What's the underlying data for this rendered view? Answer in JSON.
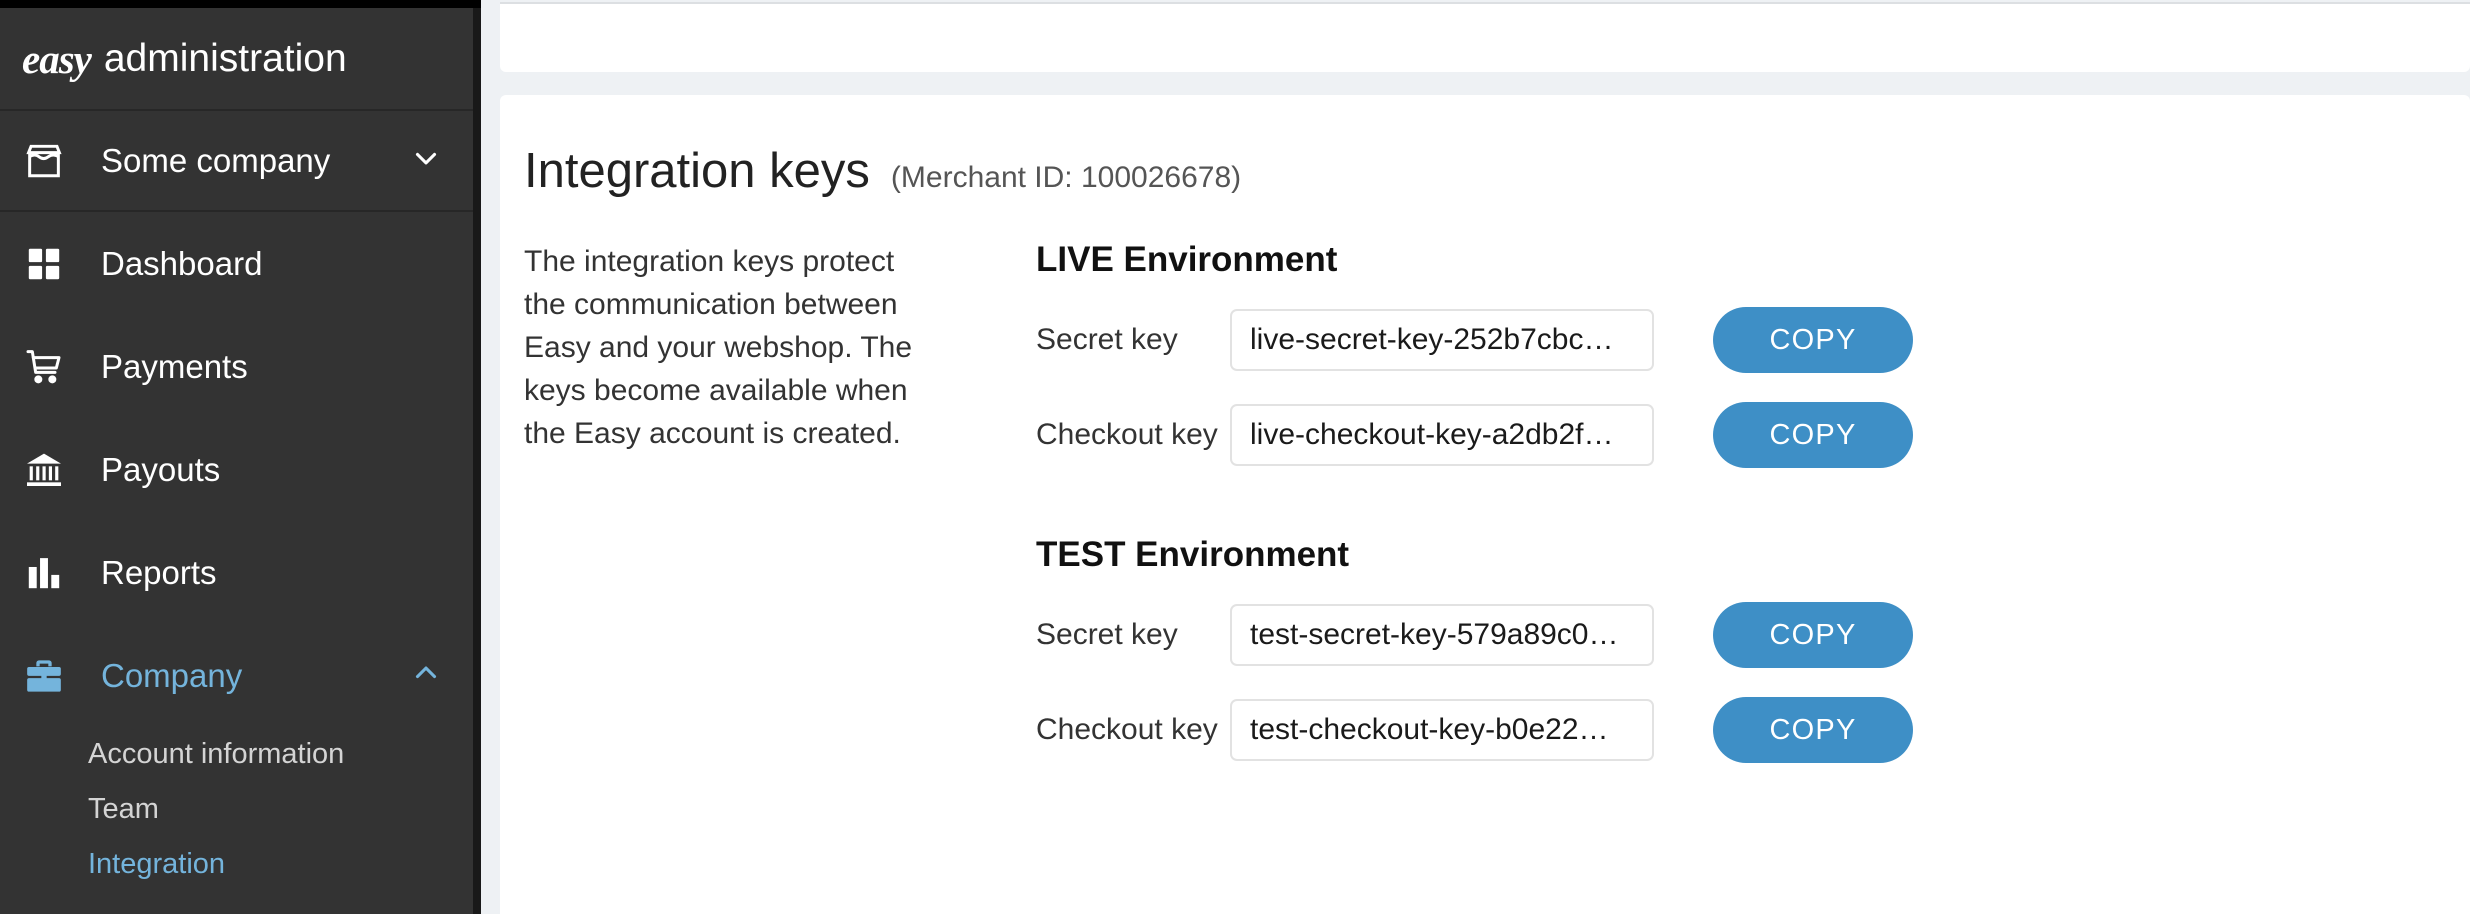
{
  "brand": {
    "logo_text": "easy",
    "app_name": "administration"
  },
  "sidebar": {
    "company_switcher": {
      "label": "Some company",
      "icon": "store-icon",
      "chevron": "chevron-down-icon"
    },
    "items": [
      {
        "label": "Dashboard",
        "icon": "dashboard-grid-icon",
        "active": false
      },
      {
        "label": "Payments",
        "icon": "shopping-cart-icon",
        "active": false
      },
      {
        "label": "Payouts",
        "icon": "bank-icon",
        "active": false
      },
      {
        "label": "Reports",
        "icon": "bar-chart-icon",
        "active": false
      },
      {
        "label": "Company",
        "icon": "briefcase-icon",
        "active": true,
        "chevron": "chevron-up-icon"
      }
    ],
    "sub_items": [
      {
        "label": "Account information",
        "active": false
      },
      {
        "label": "Team",
        "active": false
      },
      {
        "label": "Integration",
        "active": true
      }
    ],
    "accent_color": "#74b4dc",
    "background_color": "#333333"
  },
  "main": {
    "page_title": "Integration keys",
    "page_subtitle": "(Merchant ID: 100026678)",
    "description": "The integration keys protect the communication between Easy and your webshop. The keys become available when the Easy account is created.",
    "environments": [
      {
        "heading": "LIVE Environment",
        "rows": [
          {
            "label": "Secret key",
            "value": "live-secret-key-252b7cbc…",
            "button_label": "COPY"
          },
          {
            "label": "Checkout key",
            "value": "live-checkout-key-a2db2f…",
            "button_label": "COPY"
          }
        ]
      },
      {
        "heading": "TEST Environment",
        "rows": [
          {
            "label": "Secret key",
            "value": "test-secret-key-579a89c0…",
            "button_label": "COPY"
          },
          {
            "label": "Checkout key",
            "value": "test-checkout-key-b0e22…",
            "button_label": "COPY"
          }
        ]
      }
    ],
    "button_color": "#3e8fc6"
  }
}
